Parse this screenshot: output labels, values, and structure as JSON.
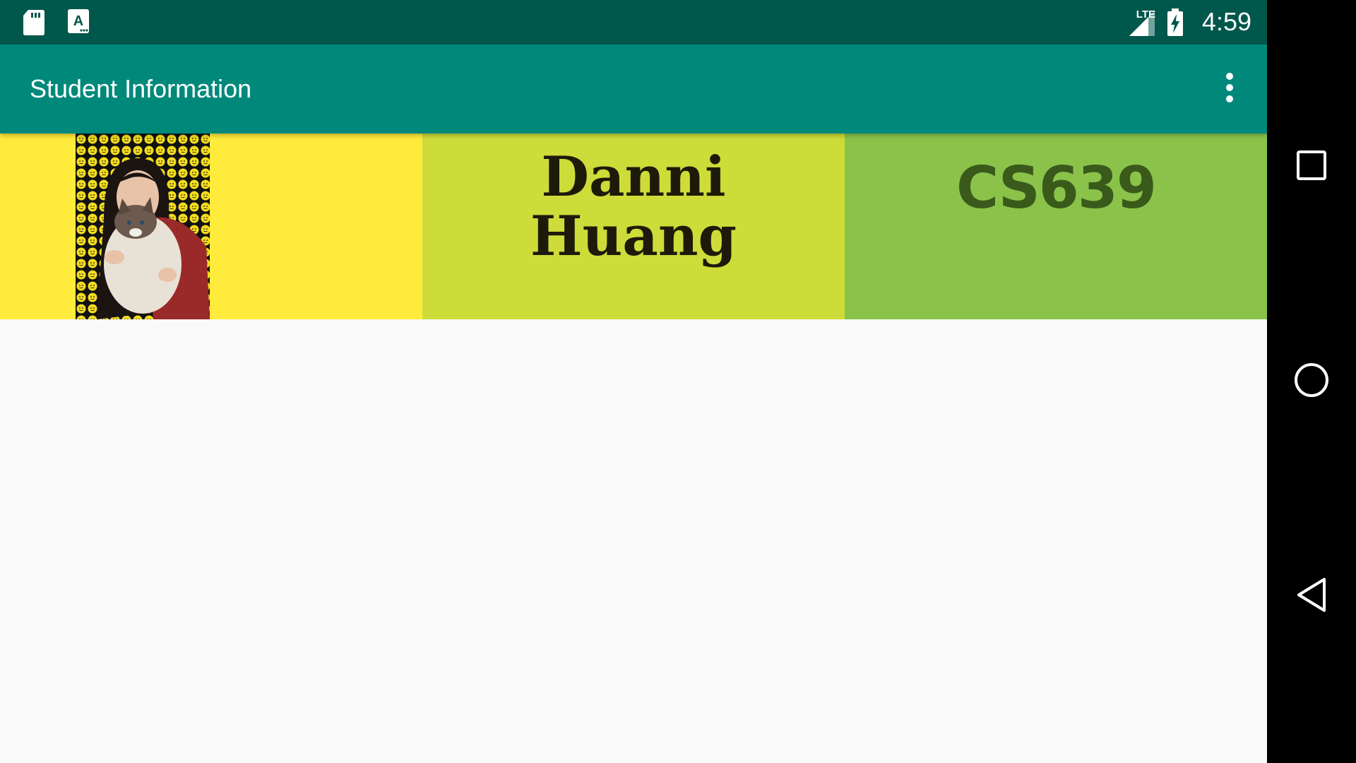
{
  "status_bar": {
    "left_icons": [
      "sd-card-icon",
      "keyboard-a-icon"
    ],
    "network_label": "LTE",
    "time": "4:59",
    "right_icons": [
      "lte-signal-icon",
      "battery-charging-icon"
    ]
  },
  "app_bar": {
    "title": "Student Information",
    "menu_icon": "overflow-menu-icon"
  },
  "student": {
    "name": "Danni\nHuang",
    "course": "CS639",
    "photo_description_icon": "student-photo"
  },
  "colors": {
    "status_bar": "#00574b",
    "app_bar": "#00897b",
    "cell_photo": "#ffeb3b",
    "cell_name": "#cddc39",
    "cell_course": "#8bc34a",
    "background": "#fafafa",
    "nav_bar": "#000000"
  },
  "nav_bar": {
    "buttons": [
      "recents-square-icon",
      "home-circle-icon",
      "back-triangle-icon"
    ]
  }
}
